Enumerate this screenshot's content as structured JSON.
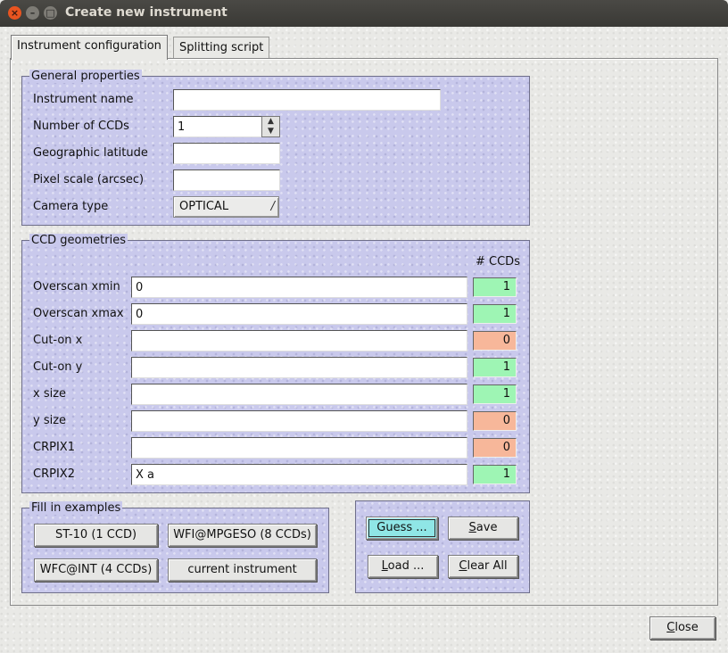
{
  "window": {
    "title": "Create new instrument"
  },
  "tabs": {
    "active": "Instrument configuration",
    "inactive": "Splitting script"
  },
  "general": {
    "title": "General properties",
    "instrument_name_label": "Instrument name",
    "instrument_name_value": "",
    "num_ccds_label": "Number of CCDs",
    "num_ccds_value": "1",
    "latitude_label": "Geographic latitude",
    "latitude_value": "",
    "pixel_scale_label": "Pixel scale (arcsec)",
    "pixel_scale_value": "",
    "camera_type_label": "Camera type",
    "camera_type_value": "OPTICAL"
  },
  "ccd": {
    "title": "CCD geometries",
    "count_header": "# CCDs",
    "rows": [
      {
        "label": "Overscan xmin",
        "value": "0",
        "count": "1",
        "status": "ok"
      },
      {
        "label": "Overscan xmax",
        "value": "0",
        "count": "1",
        "status": "ok"
      },
      {
        "label": "Cut-on x",
        "value": "",
        "count": "0",
        "status": "bad"
      },
      {
        "label": "Cut-on y",
        "value": "",
        "count": "1",
        "status": "ok"
      },
      {
        "label": "x size",
        "value": "",
        "count": "1",
        "status": "ok"
      },
      {
        "label": "y size",
        "value": "",
        "count": "0",
        "status": "bad"
      },
      {
        "label": "CRPIX1",
        "value": "",
        "count": "0",
        "status": "bad"
      },
      {
        "label": "CRPIX2",
        "value": "X a",
        "count": "1",
        "status": "ok"
      }
    ]
  },
  "examples": {
    "title": "Fill in examples",
    "st10": "ST-10 (1 CCD)",
    "wfi": "WFI@MPGESO (8 CCDs)",
    "wfc": "WFC@INT (4 CCDs)",
    "current": "current instrument"
  },
  "actions": {
    "guess": "Guess ...",
    "save": "Save",
    "load": "Load ...",
    "clear_all": "Clear All"
  },
  "close": "Close",
  "colors": {
    "count_ok": "#9ef5b4",
    "count_bad": "#f7b79a",
    "group_bg": "#c9c9ec",
    "guess_bg": "#8fe6e6"
  }
}
